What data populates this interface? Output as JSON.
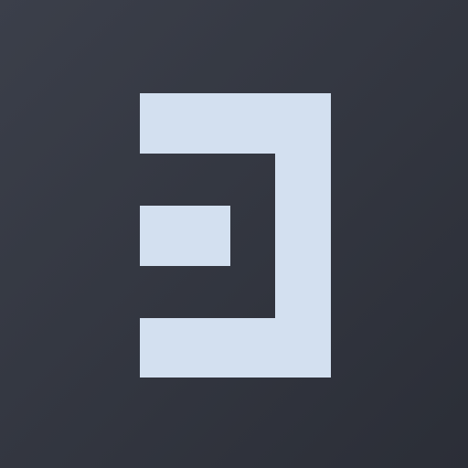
{
  "app_icon": {
    "icon": "bracket-logo-icon",
    "colors": {
      "background_start": "#3b3f4a",
      "background_end": "#2b2e37",
      "glyph": "#d3e0f0"
    }
  }
}
